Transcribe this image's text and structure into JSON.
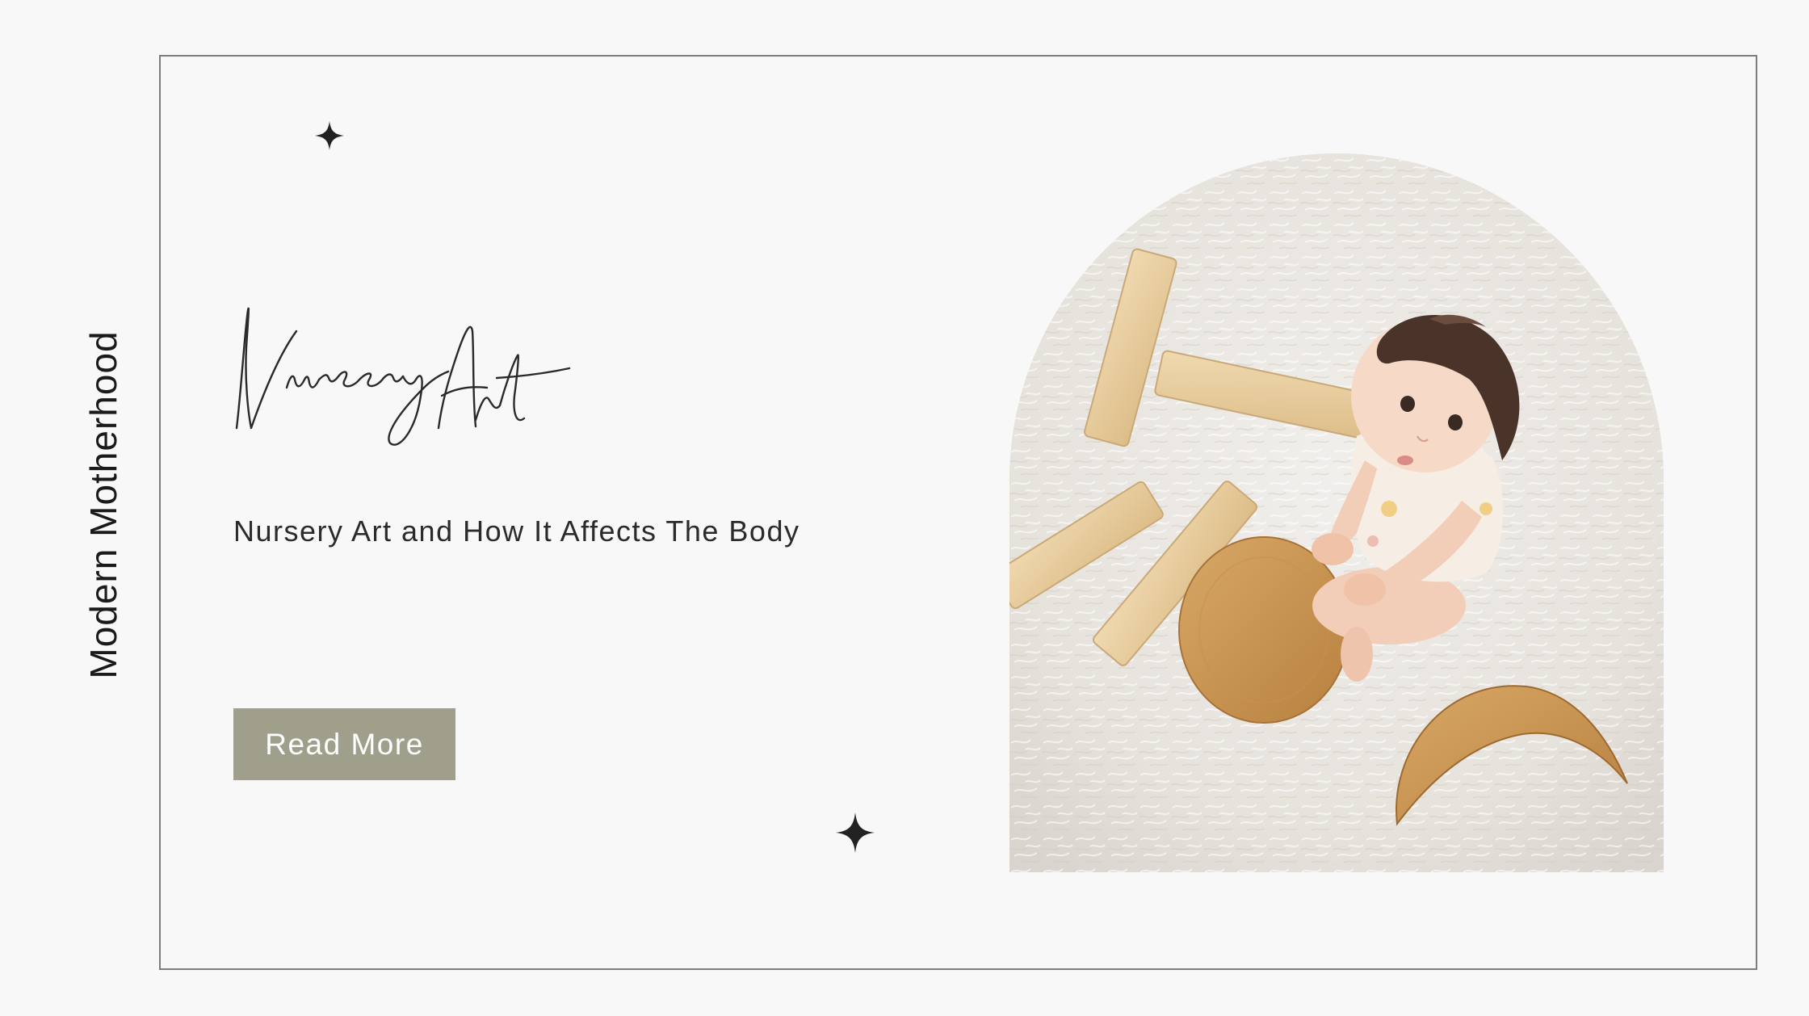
{
  "side_label": "Modern Motherhood",
  "title": "Nursery Art",
  "subtitle": "Nursery Art and How It Affects The Body",
  "button": {
    "label": "Read More"
  },
  "photo": {
    "alt": "Toddler sitting on white fluffy rug with wooden blocks"
  },
  "colors": {
    "background": "#f8f8f8",
    "frame": "#7d7d7d",
    "button": "#a09f8c",
    "text": "#222222"
  }
}
